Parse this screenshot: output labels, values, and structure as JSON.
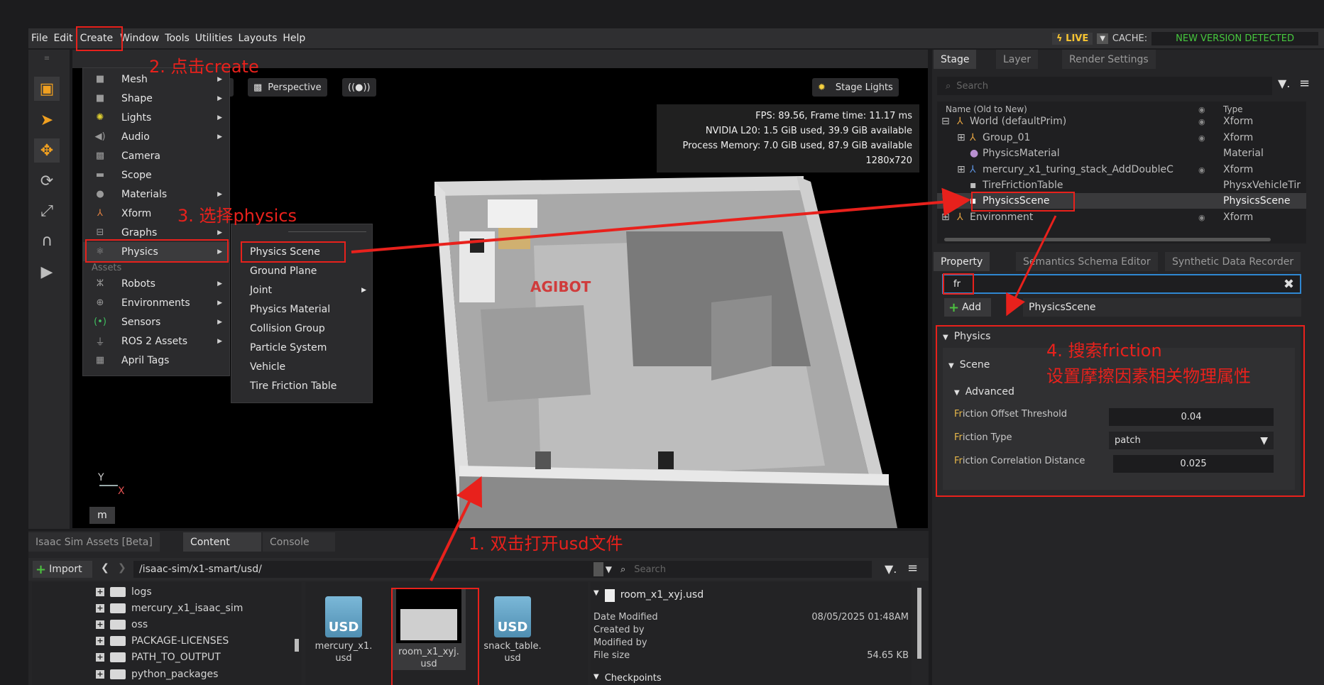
{
  "menubar": {
    "items": [
      "File",
      "Edit",
      "Create",
      "Window",
      "Tools",
      "Utilities",
      "Layouts",
      "Help"
    ],
    "live": "LIVE",
    "cache_label": "CACHE:",
    "cache_status": "NEW VERSION DETECTED"
  },
  "viewport": {
    "camera": "Perspective",
    "stage_lights": "Stage Lights",
    "stats": [
      "FPS: 89.56, Frame time: 11.17 ms",
      "NVIDIA L20: 1.5 GiB used, 39.9 GiB available",
      "Process Memory: 7.0 GiB used, 87.9 GiB available",
      "1280x720"
    ],
    "axis_y": "Y",
    "axis_x": "X",
    "m_button": "m",
    "logo_text": "AGIBOT"
  },
  "create_menu": {
    "items": [
      {
        "icon": "mesh-icon",
        "label": "Mesh",
        "submenu": true
      },
      {
        "icon": "shape-icon",
        "label": "Shape",
        "submenu": true
      },
      {
        "icon": "light-icon",
        "label": "Lights",
        "submenu": true
      },
      {
        "icon": "audio-icon",
        "label": "Audio",
        "submenu": true
      },
      {
        "icon": "camera-icon",
        "label": "Camera",
        "submenu": false
      },
      {
        "icon": "scope-icon",
        "label": "Scope",
        "submenu": false
      },
      {
        "icon": "material-icon",
        "label": "Materials",
        "submenu": true
      },
      {
        "icon": "xform-icon",
        "label": "Xform",
        "submenu": false
      },
      {
        "icon": "graph-icon",
        "label": "Graphs",
        "submenu": true
      },
      {
        "icon": "physics-icon",
        "label": "Physics",
        "submenu": true
      }
    ],
    "assets_heading": "Assets",
    "asset_items": [
      {
        "icon": "robot-icon",
        "label": "Robots",
        "submenu": true
      },
      {
        "icon": "globe-icon",
        "label": "Environments",
        "submenu": true
      },
      {
        "icon": "sensor-icon",
        "label": "Sensors",
        "submenu": true
      },
      {
        "icon": "ros-icon",
        "label": "ROS 2 Assets",
        "submenu": true
      },
      {
        "icon": "april-tag-icon",
        "label": "April Tags",
        "submenu": false
      }
    ]
  },
  "physics_submenu": {
    "items": [
      "Physics Scene",
      "Ground Plane",
      "Joint",
      "Physics Material",
      "Collision Group",
      "Particle System",
      "Vehicle",
      "Tire Friction Table"
    ]
  },
  "stage": {
    "tabs": [
      "Stage",
      "Layer",
      "Render Settings"
    ],
    "search_placeholder": "Search",
    "col_name": "Name (Old to New)",
    "col_type": "Type",
    "rows": [
      {
        "name": "World (defaultPrim)",
        "type": "Xform"
      },
      {
        "name": "Group_01",
        "type": "Xform"
      },
      {
        "name": "PhysicsMaterial",
        "type": "Material"
      },
      {
        "name": "mercury_x1_turing_stack_AddDoubleC",
        "type": "Xform"
      },
      {
        "name": "TireFrictionTable",
        "type": "PhysxVehicleTir"
      },
      {
        "name": "PhysicsScene",
        "type": "PhysicsScene"
      },
      {
        "name": "Environment",
        "type": "Xform"
      }
    ]
  },
  "property": {
    "tabs": [
      "Property",
      "Semantics Schema Editor",
      "Synthetic Data Recorder"
    ],
    "filter_value": "fr",
    "add_label": "Add",
    "prim_name": "PhysicsScene",
    "section_physics": "Physics",
    "section_scene": "Scene",
    "section_advanced": "Advanced",
    "fields": [
      {
        "label_hl": "Fr",
        "label_rest": "iction Offset Threshold",
        "value": "0.04"
      },
      {
        "label_hl": "Fr",
        "label_rest": "iction Type",
        "value": "patch"
      },
      {
        "label_hl": "Fr",
        "label_rest": "iction Correlation Distance",
        "value": "0.025"
      }
    ]
  },
  "bottom": {
    "tabs": [
      "Isaac Sim Assets [Beta]",
      "Content",
      "Console"
    ],
    "import_label": "Import",
    "path": "/isaac-sim/x1-smart/usd/",
    "search_placeholder": "Search",
    "tree": [
      "logs",
      "mercury_x1_isaac_sim",
      "oss",
      "PACKAGE-LICENSES",
      "PATH_TO_OUTPUT",
      "python_packages"
    ],
    "files": [
      {
        "name1": "mercury_x1.",
        "name2": "usd"
      },
      {
        "name1": "room_x1_xyj.",
        "name2": "usd"
      },
      {
        "name1": "snack_table.",
        "name2": "usd"
      }
    ],
    "icon_label": "USD",
    "details": {
      "file": "room_x1_xyj.usd",
      "date_label": "Date Modified",
      "date_value": "08/05/2025 01:48AM",
      "created_label": "Created by",
      "modified_label": "Modified by",
      "size_label": "File size",
      "size_value": "54.65 KB",
      "checkpoints": "Checkpoints"
    }
  },
  "annotations": {
    "step1": "1. 双击打开usd文件",
    "step2": "2. 点击create",
    "step3": "3. 选择physics",
    "step4a": "4. 搜索friction",
    "step4b": "设置摩擦因素相关物理属性"
  }
}
